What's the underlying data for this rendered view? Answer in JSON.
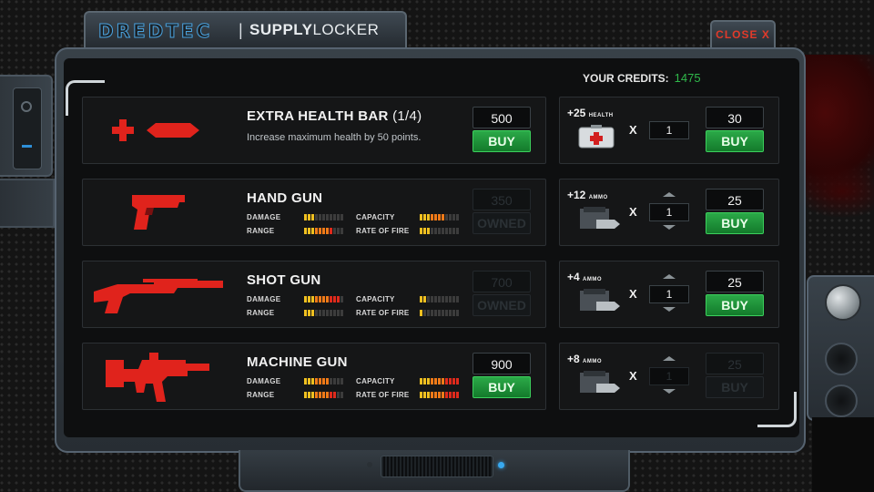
{
  "header": {
    "brand": "DREDTEC",
    "separator": "|",
    "title_bold": "SUPPLY",
    "title_rest": "LOCKER"
  },
  "close_label": "CLOSE X",
  "credits": {
    "label": "YOUR CREDITS:",
    "value": "1475"
  },
  "colors": {
    "accent_red": "#e0231c",
    "buy_green": "#1f9a3a",
    "credits_green": "#2fb84a",
    "led_blue": "#38a9f0"
  },
  "items": [
    {
      "name": "EXTRA HEALTH BAR",
      "suffix": "(1/4)",
      "description": "Increase maximum health by 50 points.",
      "icon": "health-bar-icon",
      "price": "500",
      "button": "BUY",
      "available": true,
      "ammo": {
        "amount": "+25",
        "unit": "HEALTH",
        "icon": "medkit-icon",
        "x": "X",
        "qty": "1",
        "price": "30",
        "button": "BUY",
        "arrows": false,
        "available": true
      }
    },
    {
      "name": "HAND GUN",
      "suffix": "",
      "icon": "handgun-icon",
      "stats": {
        "damage_label": "DAMAGE",
        "range_label": "RANGE",
        "capacity_label": "CAPACITY",
        "rate_label": "RATE OF FIRE",
        "damage": 0.3,
        "range": 0.7,
        "capacity": 0.6,
        "rate": 0.3
      },
      "price": "350",
      "button": "OWNED",
      "available": false,
      "ammo": {
        "amount": "+12",
        "unit": "AMMO",
        "icon": "ammo-clip-icon",
        "x": "X",
        "qty": "1",
        "price": "25",
        "button": "BUY",
        "arrows": true,
        "available": true
      }
    },
    {
      "name": "SHOT GUN",
      "suffix": "",
      "icon": "shotgun-icon",
      "stats": {
        "damage_label": "DAMAGE",
        "range_label": "RANGE",
        "capacity_label": "CAPACITY",
        "rate_label": "RATE OF FIRE",
        "damage": 0.9,
        "range": 0.3,
        "capacity": 0.2,
        "rate": 0.1
      },
      "price": "700",
      "button": "OWNED",
      "available": false,
      "ammo": {
        "amount": "+4",
        "unit": "AMMO",
        "icon": "ammo-clip-icon",
        "x": "X",
        "qty": "1",
        "price": "25",
        "button": "BUY",
        "arrows": true,
        "available": true
      }
    },
    {
      "name": "MACHINE GUN",
      "suffix": "",
      "icon": "machinegun-icon",
      "stats": {
        "damage_label": "DAMAGE",
        "range_label": "RANGE",
        "capacity_label": "CAPACITY",
        "rate_label": "RATE OF FIRE",
        "damage": 0.6,
        "range": 0.8,
        "capacity": 1.0,
        "rate": 1.0
      },
      "price": "900",
      "button": "BUY",
      "available": true,
      "ammo": {
        "amount": "+8",
        "unit": "AMMO",
        "icon": "ammo-clip-icon",
        "x": "X",
        "qty": "1",
        "price": "25",
        "button": "BUY",
        "arrows": true,
        "available": false
      }
    }
  ]
}
